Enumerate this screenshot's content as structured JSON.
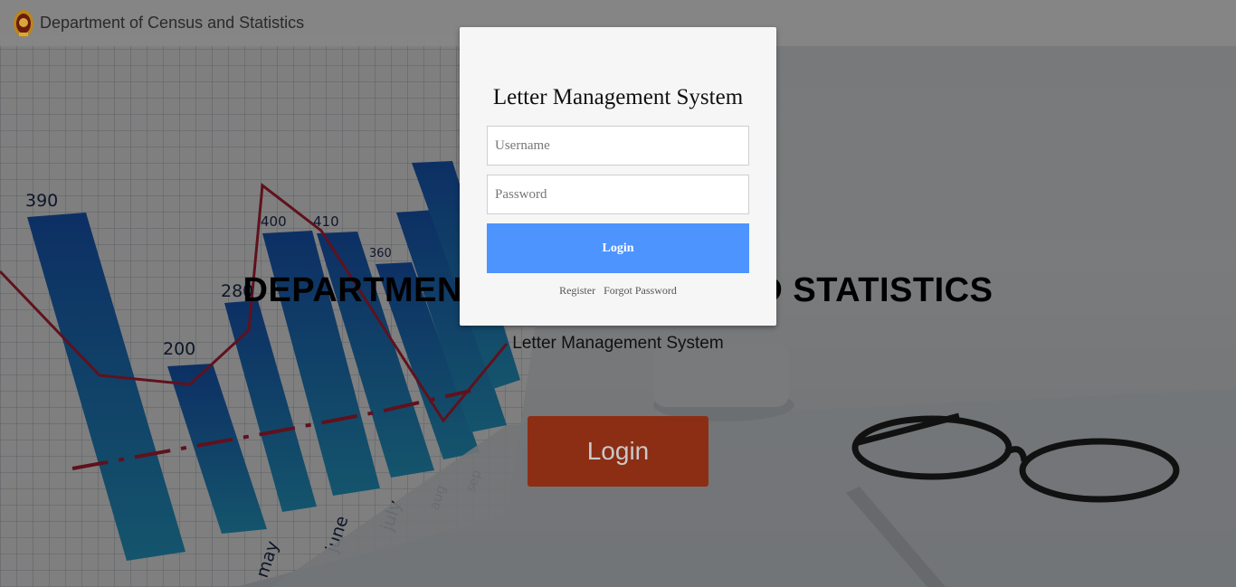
{
  "header": {
    "brand": "Department of Census and Statistics",
    "emblem_icon": "sri-lanka-emblem-icon"
  },
  "hero": {
    "title": "DEPARTMENT OF CENSUS AND STATISTICS",
    "subtitle": "Letter Management System",
    "login_label": "Login"
  },
  "modal": {
    "title": "Letter Management System",
    "username_placeholder": "Username",
    "password_placeholder": "Password",
    "login_label": "Login",
    "register_label": "Register",
    "forgot_label": "Forgot Password"
  },
  "background_chart_labels": {
    "values": [
      "390",
      "200",
      "280",
      "400",
      "410",
      "360"
    ],
    "months": [
      "may",
      "june",
      "july",
      "aug",
      "sep"
    ]
  },
  "colors": {
    "modal_button": "#4d94ff",
    "hero_button": "#8c2e14",
    "chart_bars": "#1e6fd0",
    "chart_line": "#c0233b"
  }
}
